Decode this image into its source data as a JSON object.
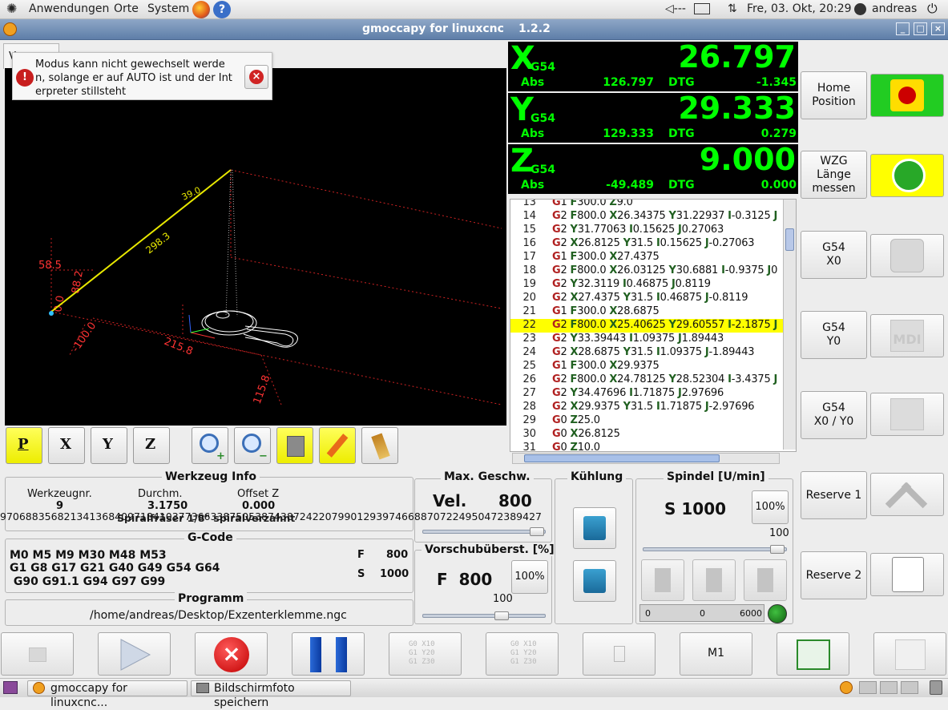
{
  "top_panel": {
    "menu_applications": "Anwendungen",
    "menu_places": "Orte",
    "menu_system": "System",
    "volume": "◁---",
    "datetime": "Fre, 03. Okt, 20:29",
    "user": "andreas"
  },
  "window": {
    "title": "gmoccapy for linuxcnc",
    "version": "1.2.2"
  },
  "tab": {
    "label": "V"
  },
  "notification": {
    "message": "Modus kann nicht gewechselt werden, solange er auf AUTO ist und der Interpreter stillsteht",
    "line1": "Modus kann nicht gewechselt werde",
    "line2": "n, solange er auf AUTO ist und der Int",
    "line3": "erpreter stillsteht"
  },
  "preview_labels": {
    "dim_a": "58.5",
    "dim_b": "88.2",
    "dim_c": "0.0",
    "dim_d": "-100.0",
    "dim_e": "215.8",
    "dim_f": "115.8",
    "dim_g": "298.3",
    "dim_h": "39.0"
  },
  "view_buttons": [
    "P",
    "X",
    "Y",
    "Z"
  ],
  "dro": {
    "x": {
      "axis": "X",
      "cs": "G54",
      "value": "26.797",
      "abs_label": "Abs",
      "abs": "126.797",
      "dtg_label": "DTG",
      "dtg": "-1.345"
    },
    "y": {
      "axis": "Y",
      "cs": "G54",
      "value": "29.333",
      "abs_label": "Abs",
      "abs": "129.333",
      "dtg_label": "DTG",
      "dtg": "0.279"
    },
    "z": {
      "axis": "Z",
      "cs": "G54",
      "value": "9.000",
      "abs_label": "Abs",
      "abs": "-49.489",
      "dtg_label": "DTG",
      "dtg": "0.000"
    }
  },
  "gcode_lines": [
    {
      "n": "13",
      "t": "G1 F300.0 Z9.0"
    },
    {
      "n": "14",
      "t": "G2 F800.0 X26.34375 Y31.22937 I-0.3125 J"
    },
    {
      "n": "15",
      "t": "G2 Y31.77063 I0.15625 J0.27063"
    },
    {
      "n": "16",
      "t": "G2 X26.8125 Y31.5 I0.15625 J-0.27063"
    },
    {
      "n": "17",
      "t": "G1 F300.0 X27.4375"
    },
    {
      "n": "18",
      "t": "G2 F800.0 X26.03125 Y30.6881 I-0.9375 J0"
    },
    {
      "n": "19",
      "t": "G2 Y32.3119 I0.46875 J0.8119"
    },
    {
      "n": "20",
      "t": "G2 X27.4375 Y31.5 I0.46875 J-0.8119"
    },
    {
      "n": "21",
      "t": "G1 F300.0 X28.6875"
    },
    {
      "n": "22",
      "t": "G2 F800.0 X25.40625 Y29.60557 I-2.1875 J"
    },
    {
      "n": "23",
      "t": "G2 Y33.39443 I1.09375 J1.89443"
    },
    {
      "n": "24",
      "t": "G2 X28.6875 Y31.5 I1.09375 J-1.89443"
    },
    {
      "n": "25",
      "t": "G1 F300.0 X29.9375"
    },
    {
      "n": "26",
      "t": "G2 F800.0 X24.78125 Y28.52304 I-3.4375 J"
    },
    {
      "n": "27",
      "t": "G2 Y34.47696 I1.71875 J2.97696"
    },
    {
      "n": "28",
      "t": "G2 X29.9375 Y31.5 I1.71875 J-2.97696"
    },
    {
      "n": "29",
      "t": "G0 Z25.0"
    },
    {
      "n": "30",
      "t": "G0 X26.8125"
    },
    {
      "n": "31",
      "t": "G0 Z10.0"
    }
  ],
  "gcode_highlight_line": "22",
  "side_buttons": [
    {
      "label1": "Home",
      "label2": "Position",
      "label3": ""
    },
    {
      "label1": "WZG",
      "label2": "Länge",
      "label3": "messen"
    },
    {
      "label1": "G54",
      "label2": "X0",
      "label3": ""
    },
    {
      "label1": "G54",
      "label2": "Y0",
      "label3": ""
    },
    {
      "label1": "G54",
      "label2": "X0 / Y0",
      "label3": ""
    },
    {
      "label1": "Reserve 1",
      "label2": "",
      "label3": ""
    },
    {
      "label1": "Reserve 2",
      "label2": "",
      "label3": ""
    }
  ],
  "tool_info": {
    "title": "Werkzeug Info",
    "col_nr": "Werkzeugnr.",
    "col_diam": "Durchm.",
    "col_offset": "Offset Z",
    "nr": "9",
    "diam": "3.1750",
    "offset": "0.000",
    "description": "Spiralfräser 1/8\" spiralverzahnt",
    "overflow_text": "9706883568213413684097184103773663387505387438724220799012939746688707224950472389427"
  },
  "gcode_info": {
    "title": "G-Code",
    "line1": "M0 M5 M9 M30 M48 M53",
    "line2": "G1 G8 G17 G21 G40 G49 G54 G64",
    "line3": " G90 G91.1 G94 G97 G99",
    "f_label": "F",
    "f_value": "800",
    "s_label": "S",
    "s_value": "1000"
  },
  "program": {
    "title": "Programm",
    "path": "/home/andreas/Desktop/Exzenterklemme.ngc"
  },
  "max_vel": {
    "title": "Max. Geschw.",
    "label": "Vel.",
    "value": "800"
  },
  "feed_override": {
    "title": "Vorschubüberst. [%]",
    "label": "F  800",
    "button": "100%",
    "value": "100"
  },
  "coolant": {
    "title": "Kühlung"
  },
  "spindle": {
    "title": "Spindel [U/min]",
    "label": "S 1000",
    "button": "100%",
    "value": "100",
    "bar_min": "0",
    "bar_cur": "0",
    "bar_max": "6000"
  },
  "bottom_buttons": {
    "m1": "M1",
    "g0_line1": "G0 X10",
    "g0_line2": "G1 Y20",
    "g0_line3": "G1 Z30"
  },
  "taskbar": {
    "task1": "gmoccapy for linuxcnc...",
    "task2": "Bildschirmfoto speichern"
  },
  "colors": {
    "dro_bg": "#000000",
    "dro_fg": "#00ff00",
    "highlight": "#ffff00",
    "estop_green": "#22cc22",
    "power_yellow": "#ffff00"
  }
}
